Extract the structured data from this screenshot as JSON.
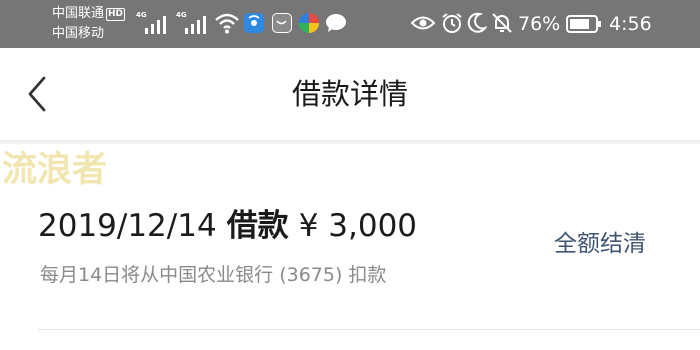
{
  "status_bar": {
    "carrier_primary": "中国联通",
    "carrier_secondary": "中国移动",
    "hd_badge": "HD",
    "sim1_label": "4G",
    "sim2_label": "4G",
    "battery_percent": "76%",
    "time": "4:56",
    "icons": [
      "signal-icon",
      "wifi-icon",
      "app-icons",
      "eye-icon",
      "alarm-icon",
      "moon-icon",
      "mute-bell-icon",
      "battery-icon"
    ]
  },
  "nav": {
    "back_icon": "chevron-left-icon",
    "title": "借款详情"
  },
  "watermark": "流浪者",
  "loan": {
    "date": "2019/12/14",
    "type": "借款",
    "amount": "¥ 3,000",
    "repay_note": "每月14日将从中国农业银行 (3675) 扣款",
    "action_label": "全额结清"
  },
  "colors": {
    "status_bar_bg": "#767676",
    "link": "#3f5571",
    "watermark": "#f1e5b0",
    "subtext": "#8a8a8a"
  }
}
